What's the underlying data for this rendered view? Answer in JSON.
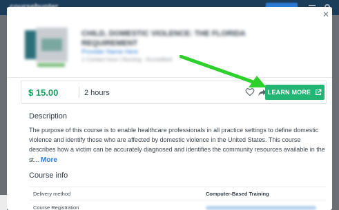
{
  "topbar": {
    "brand": "coursehunter"
  },
  "header": {
    "title": "CHILD, DOMESTIC VIOLENCE: THE FLORIDA REQUIREMENT",
    "provider": "Provider Name Here",
    "meta": "1 Contact hour | Nursing - Accredited"
  },
  "offer": {
    "price": "$ 15.00",
    "duration": "2 hours",
    "learn_more_label": "LEARN MORE"
  },
  "description": {
    "heading": "Description",
    "text": "The purpose of this course is to enable healthcare professionals in all practice settings to define domestic violence and identify those who are affected by domestic violence in the United States. This course describes how a victim can be accurately diagnosed and identifies the community resources available in the st...",
    "more_label": "More"
  },
  "course_info": {
    "heading": "Course info",
    "rows": [
      {
        "label": "Delivery method",
        "value": "Computer-Based Training"
      },
      {
        "label": "Course Registration",
        "value": ""
      }
    ]
  },
  "colors": {
    "accent": "#22b573",
    "price": "#1e9a5e",
    "link": "#2a7ad1",
    "annotation_arrow": "#2ed02b"
  },
  "icons": [
    "heart-icon",
    "share-icon",
    "external-link-icon",
    "close-icon"
  ]
}
